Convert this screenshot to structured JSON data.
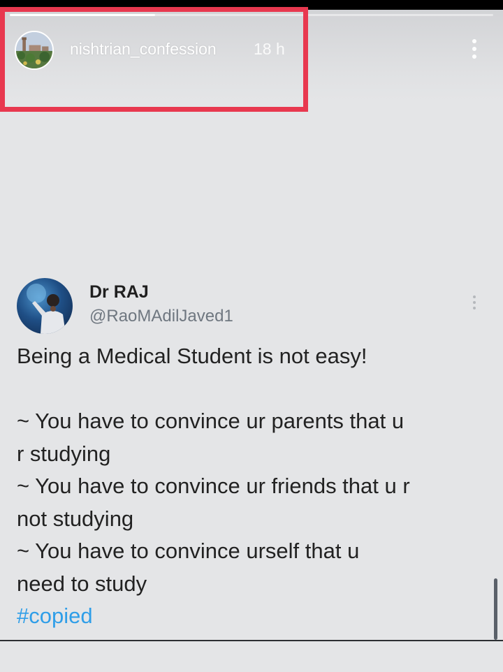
{
  "story": {
    "username": "nishtrian_confession",
    "time": "18 h",
    "progress": 0.3,
    "more_icon": "more-vertical-icon"
  },
  "tweet": {
    "name": "Dr RAJ",
    "handle": "@RaoMAdilJaved1",
    "menu_icon": "more-vertical-icon",
    "lines": [
      "Being a Medical Student is not easy!",
      "",
      "~ You have to convince ur parents that u",
      "r studying",
      "~ You have to convince ur friends that u r",
      "not studying",
      "~ You have to convince urself that u",
      "need to study"
    ],
    "hashtag": "#copied"
  },
  "colors": {
    "highlight_border": "#e8384f",
    "hashtag": "#2f9ee8",
    "background": "#e4e5e7"
  }
}
